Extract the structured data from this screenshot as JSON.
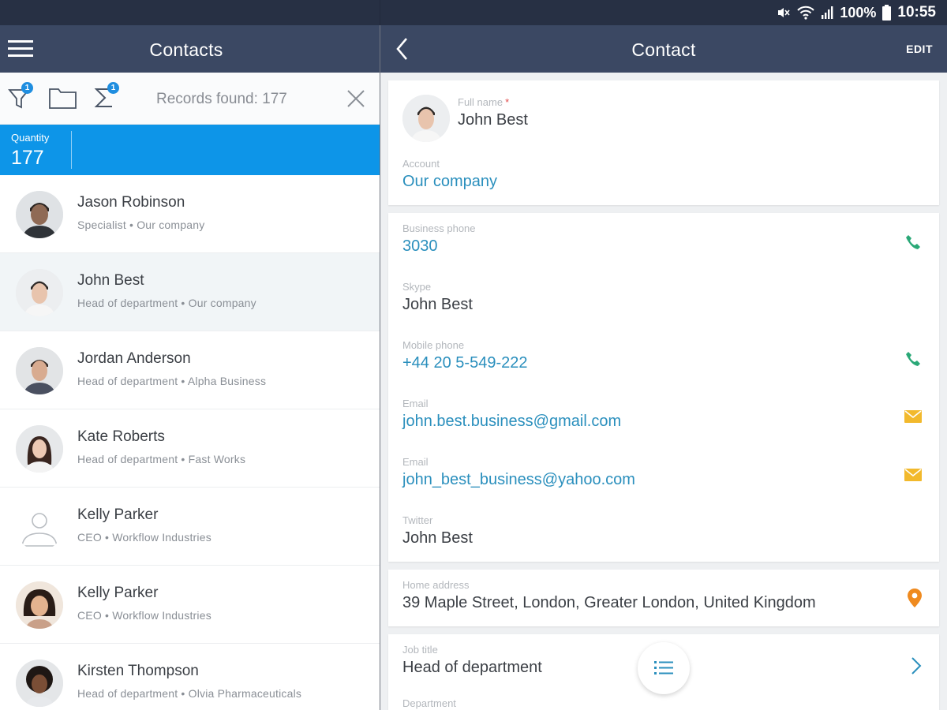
{
  "status_bar": {
    "battery_percent": "100%",
    "time": "10:55"
  },
  "left_header": {
    "title": "Contacts"
  },
  "right_header": {
    "title": "Contact",
    "edit_label": "EDIT"
  },
  "filter_bar": {
    "filter_badge": "1",
    "sum_badge": "1",
    "records_found": "Records found: 177"
  },
  "quantity": {
    "label": "Quantity",
    "value": "177"
  },
  "contacts": [
    {
      "name": "Jason Robinson",
      "subtitle": "Specialist • Our company",
      "avatar": "photo-man-dark-hair"
    },
    {
      "name": "John Best",
      "subtitle": "Head of department • Our company",
      "avatar": "photo-man-smiling",
      "selected": true
    },
    {
      "name": "Jordan Anderson",
      "subtitle": "Head of department • Alpha Business",
      "avatar": "photo-man-short-hair"
    },
    {
      "name": "Kate Roberts",
      "subtitle": "Head of department • Fast Works",
      "avatar": "photo-woman-long-hair"
    },
    {
      "name": "Kelly Parker",
      "subtitle": "CEO • Workflow Industries",
      "avatar": "placeholder-person-icon"
    },
    {
      "name": "Kelly Parker",
      "subtitle": "CEO • Workflow Industries",
      "avatar": "photo-woman-smiling"
    },
    {
      "name": "Kirsten Thompson",
      "subtitle": "Head of department • Olvia Pharmaceuticals",
      "avatar": "photo-woman-curly-hair"
    }
  ],
  "contact_detail": {
    "full_name_label": "Full name",
    "full_name_required_mark": "*",
    "full_name": "John Best",
    "account_label": "Account",
    "account": "Our company",
    "business_phone_label": "Business phone",
    "business_phone": "3030",
    "skype_label": "Skype",
    "skype": "John Best",
    "mobile_phone_label": "Mobile phone",
    "mobile_phone": "+44 20 5-549-222",
    "email1_label": "Email",
    "email1": "john.best.business@gmail.com",
    "email2_label": "Email",
    "email2": "john_best_business@yahoo.com",
    "twitter_label": "Twitter",
    "twitter": "John Best",
    "home_address_label": "Home address",
    "home_address": "39 Maple Street, London, Greater London, United Kingdom",
    "job_title_label": "Job title",
    "job_title": "Head of department",
    "department_label": "Department"
  },
  "colors": {
    "status_bar": "#273044",
    "header": "#3b4863",
    "accent_blue": "#0d95e8",
    "link": "#2a8fbd",
    "phone_green": "#2aa877",
    "email_yellow": "#f2b92c",
    "location_orange": "#ef8a1f"
  }
}
